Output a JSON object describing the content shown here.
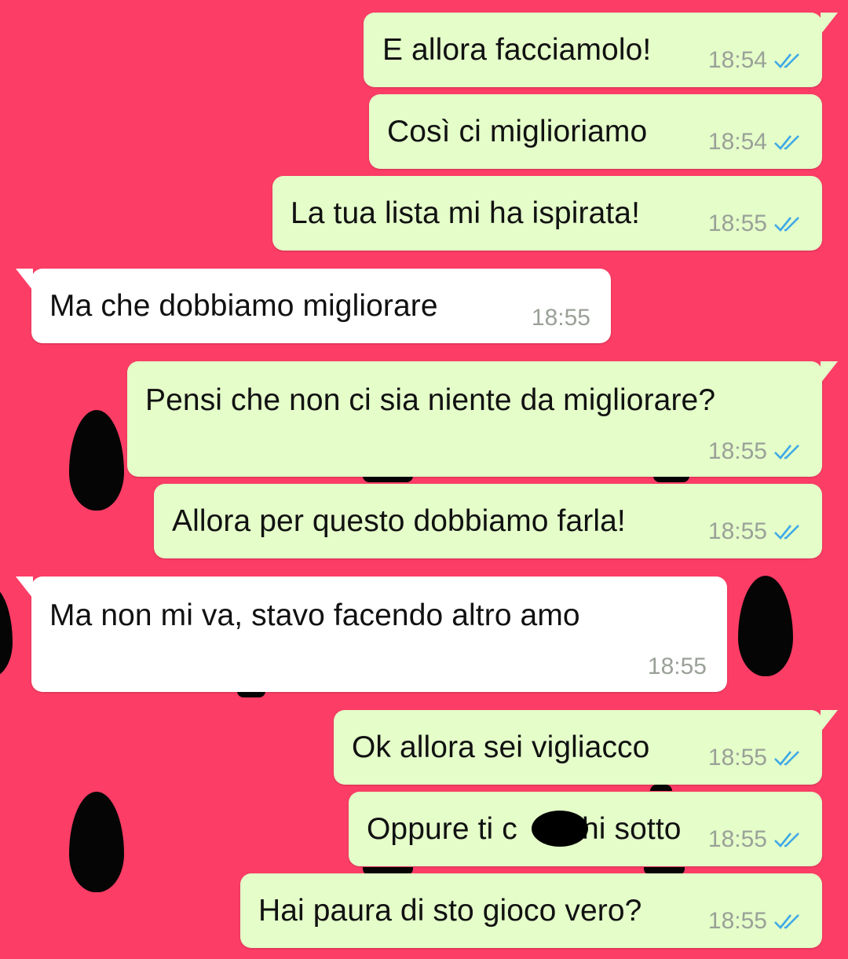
{
  "chat": {
    "messages": [
      {
        "direction": "outgoing",
        "text": "E allora facciamolo!",
        "time": "18:54",
        "status": "read"
      },
      {
        "direction": "outgoing",
        "text": "Così ci miglioriamo",
        "time": "18:54",
        "status": "read"
      },
      {
        "direction": "outgoing",
        "text": "La tua lista mi ha ispirata!",
        "time": "18:55",
        "status": "read"
      },
      {
        "direction": "incoming",
        "text": "Ma che dobbiamo migliorare",
        "time": "18:55"
      },
      {
        "direction": "outgoing",
        "text": "Pensi che non ci sia niente da migliorare?",
        "time": "18:55",
        "status": "read"
      },
      {
        "direction": "outgoing",
        "text": "Allora per questo dobbiamo farla!",
        "time": "18:55",
        "status": "read"
      },
      {
        "direction": "incoming",
        "text": "Ma non mi va, stavo facendo altro amo",
        "time": "18:55"
      },
      {
        "direction": "outgoing",
        "text": "Ok allora sei vigliacco",
        "time": "18:55",
        "status": "read"
      },
      {
        "direction": "outgoing",
        "text_before": "Oppure ti c",
        "text_after": "hi sotto",
        "time": "18:55",
        "status": "read",
        "redacted": true
      },
      {
        "direction": "outgoing",
        "text": "Hai paura di sto gioco vero?",
        "time": "18:55",
        "status": "read"
      }
    ]
  },
  "colors": {
    "background": "#fc3d66",
    "outgoing_bubble": "#e4fdc9",
    "incoming_bubble": "#ffffff",
    "read_ticks": "#3fa9e6",
    "seed": "#050505"
  }
}
